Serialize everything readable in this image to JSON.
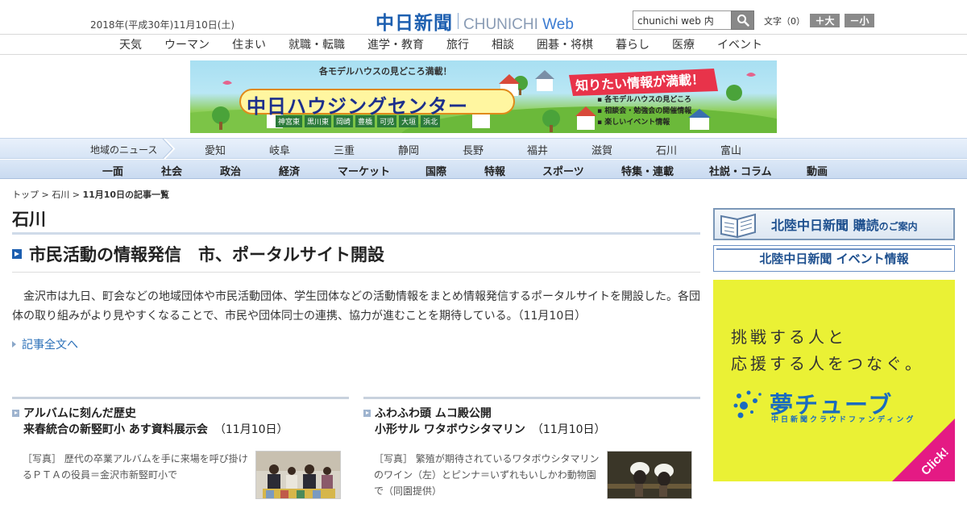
{
  "header": {
    "date": "2018年(平成30年)11月10日(土)",
    "logo_jp": "中日新聞",
    "logo_en": "CHUNICHI",
    "logo_web": "Web",
    "search_value": "chunichi web 内",
    "fontsize_label": "文字（0）",
    "font_larger": "＋大",
    "font_smaller": "－小"
  },
  "topnav": [
    "天気",
    "ウーマン",
    "住まい",
    "就職・転職",
    "進学・教育",
    "旅行",
    "相談",
    "囲碁・将棋",
    "暮らし",
    "医療",
    "イベント"
  ],
  "banner": {
    "top_text": "各モデルハウスの見どころ満載！",
    "title": "中日ハウジングセンター",
    "towns": [
      "神宮東",
      "黒川東",
      "岡崎",
      "豊橋",
      "可児",
      "大垣",
      "浜北"
    ],
    "badge": "知りたい情報が満載！",
    "bullets": [
      "各モデルハウスの見どころ",
      "相談会・勉強会の開催情報",
      "楽しいイベント情報"
    ]
  },
  "regionnav": {
    "label": "地域のニュース",
    "items": [
      "愛知",
      "岐阜",
      "三重",
      "静岡",
      "長野",
      "福井",
      "滋賀",
      "石川",
      "富山"
    ]
  },
  "secnav": [
    "一面",
    "社会",
    "政治",
    "経済",
    "マーケット",
    "国際",
    "特報",
    "スポーツ",
    "特集・連載",
    "社説・コラム",
    "動画"
  ],
  "breadcrumb": {
    "top": "トップ",
    "sep1": " > ",
    "region": "石川",
    "sep2": " > ",
    "current": "11月10日の記事一覧"
  },
  "page_title": "石川",
  "lead_article": {
    "headline": "市民活動の情報発信　市、ポータルサイト開設",
    "body": "金沢市は九日、町会などの地域団体や市民活動団体、学生団体などの活動情報をまとめ情報発信するポータルサイトを開設した。各団体の取り組みがより見やすくなることで、市民や団体同士の連携、協力が進むことを期待している。（11月10日）",
    "more": "記事全文へ"
  },
  "cards": [
    {
      "line1": "アルバムに刻んだ歴史",
      "line2": "来春統合の新竪町小 あす資料展示会",
      "date": "（11月10日）",
      "caption": "［写真］ 歴代の卒業アルバムを手に来場を呼び掛けるＰＴＡの役員＝金沢市新竪町小で"
    },
    {
      "line1": "ふわふわ頭 ムコ殿公開",
      "line2": "小形サル ワタボウシタマリン",
      "date": "（11月10日）",
      "caption": "［写真］ 繁殖が期待されているワタボウシタマリンのワイン（左）とピンナ＝いずれもいしかわ動物園で（同園提供）"
    }
  ],
  "sidebar": {
    "subscribe_main": "北陸中日新聞 購読",
    "subscribe_small": "のご案内",
    "event": "北陸中日新聞 イベント情報",
    "ad_line1": "挑戦する人と",
    "ad_line2": "応援する人をつなぐ。",
    "ad_brand": "夢チューブ",
    "ad_sub": "中日新聞クラウドファンディング",
    "ad_click": "Click!"
  },
  "colors": {
    "brand_blue": "#1d5fb0",
    "nav_bg": "#d6e4f5",
    "ad_yellow": "#eaf135",
    "ad_pink": "#e41a84"
  }
}
